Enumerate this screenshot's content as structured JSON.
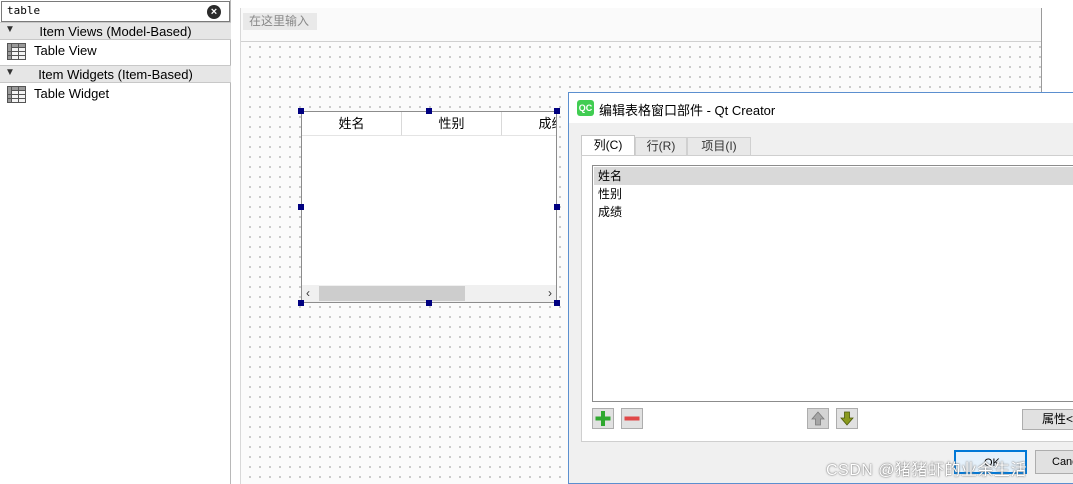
{
  "widget_box": {
    "search_value": "table",
    "categories": [
      {
        "label": "Item Views (Model-Based)",
        "items": [
          "Table View"
        ]
      },
      {
        "label": "Item Widgets (Item-Based)",
        "items": [
          "Table Widget"
        ]
      }
    ]
  },
  "editor": {
    "menubar_placeholder": "在这里输入",
    "table_widget": {
      "headers": [
        "姓名",
        "性别",
        "成绩"
      ]
    }
  },
  "dialog": {
    "title": "编辑表格窗口部件 - Qt Creator",
    "tabs": [
      "列(C)",
      "行(R)",
      "项目(I)"
    ],
    "columns_list": [
      "姓名",
      "性别",
      "成绩"
    ],
    "selected_index": 0,
    "properties_button": "属性<<",
    "ok_button": "OK",
    "cancel_button": "Cancel"
  },
  "watermark": "CSDN @猪猪虾的业余生活",
  "colors": {
    "selection_handle": "#000080",
    "dialog_border": "#5b8fcf",
    "default_button_border": "#0078d7",
    "qt_logo": "#41cd52"
  }
}
